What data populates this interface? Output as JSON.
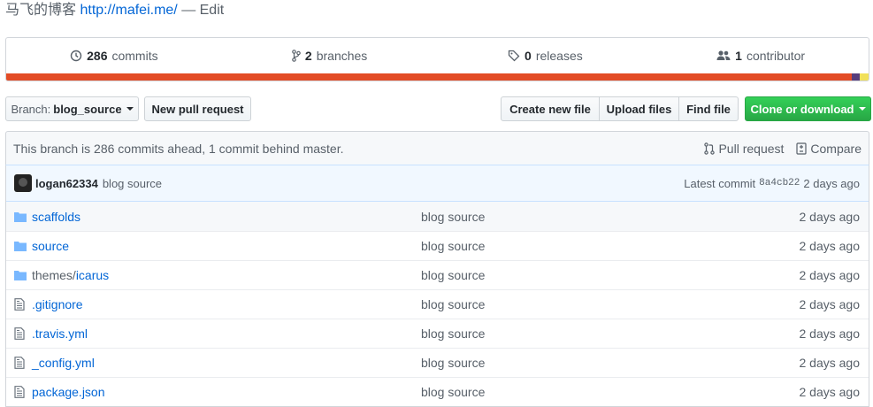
{
  "description": {
    "text": "马飞的博客",
    "url": "http://mafei.me/",
    "edit": "— Edit"
  },
  "summary": {
    "commits_count": "286",
    "commits_label": "commits",
    "branches_count": "2",
    "branches_label": "branches",
    "releases_count": "0",
    "releases_label": "releases",
    "contributors_count": "1",
    "contributors_label": "contributor",
    "languages": [
      {
        "color": "#e34c26",
        "percent": 98.0
      },
      {
        "color": "#563d7c",
        "percent": 1.0
      },
      {
        "color": "#f1e05a",
        "percent": 1.0
      }
    ]
  },
  "toolbar": {
    "branch_prefix": "Branch:",
    "branch_name": "blog_source",
    "new_pull_request": "New pull request",
    "create_new_file": "Create new file",
    "upload_files": "Upload files",
    "find_file": "Find file",
    "clone_download": "Clone or download",
    "clone_color": "#28a745"
  },
  "branch_info": {
    "text": "This branch is 286 commits ahead, 1 commit behind master.",
    "pull_request": "Pull request",
    "compare": "Compare"
  },
  "commit": {
    "author": "logan62334",
    "message": "blog source",
    "latest_label": "Latest commit",
    "sha": "8a4cb22",
    "age": "2 days ago"
  },
  "files": [
    {
      "type": "folder",
      "name": "scaffolds",
      "prefix": "",
      "message": "blog source",
      "age": "2 days ago"
    },
    {
      "type": "folder",
      "name": "source",
      "prefix": "",
      "message": "blog source",
      "age": "2 days ago"
    },
    {
      "type": "folder",
      "name": "icarus",
      "prefix": "themes/",
      "message": "blog source",
      "age": "2 days ago"
    },
    {
      "type": "file",
      "name": ".gitignore",
      "prefix": "",
      "message": "blog source",
      "age": "2 days ago"
    },
    {
      "type": "file",
      "name": ".travis.yml",
      "prefix": "",
      "message": "blog source",
      "age": "2 days ago"
    },
    {
      "type": "file",
      "name": "_config.yml",
      "prefix": "",
      "message": "blog source",
      "age": "2 days ago"
    },
    {
      "type": "file",
      "name": "package.json",
      "prefix": "",
      "message": "blog source",
      "age": "2 days ago"
    }
  ]
}
